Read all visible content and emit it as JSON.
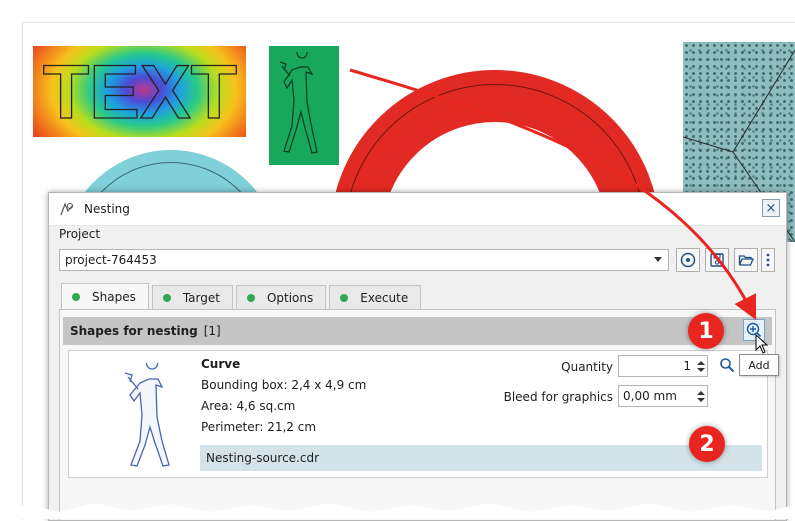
{
  "canvas": {
    "text_art": "TEXT"
  },
  "dialog": {
    "title": "Nesting",
    "close_glyph": "×",
    "project_label": "Project",
    "project_value": "project-764453",
    "tabs": [
      {
        "label": "Shapes",
        "active": true,
        "status_color": "#33a852"
      },
      {
        "label": "Target",
        "active": false,
        "status_color": "#33a852"
      },
      {
        "label": "Options",
        "active": false,
        "status_color": "#33a852"
      },
      {
        "label": "Execute",
        "active": false,
        "status_color": "#33a852"
      }
    ],
    "shapes_section": {
      "title": "Shapes for nesting",
      "count": "[1]",
      "add_tooltip": "Add"
    },
    "shape": {
      "name": "Curve",
      "bounding_box": "Bounding box: 2,4 x 4,9 cm",
      "area": "Area: 4,6 sq.cm",
      "perimeter": "Perimeter: 21,2 cm",
      "source": "Nesting-source.cdr",
      "quantity_label": "Quantity",
      "quantity_value": "1",
      "bleed_label": "Bleed for graphics",
      "bleed_value": "0,00 mm"
    }
  },
  "callouts": [
    "1",
    "2"
  ],
  "colors": {
    "callout": "#e8251f",
    "arrow": "#e8251f",
    "source_bar": "#d4e2ea",
    "section_header": "#c5c5c5"
  },
  "icons": [
    "nesting-icon",
    "close-icon",
    "help-circle-icon",
    "save-icon",
    "folder-open-icon",
    "more-vertical-icon",
    "add-circle-icon",
    "magnifier-icon",
    "cursor-icon",
    "chevron-down-icon"
  ]
}
